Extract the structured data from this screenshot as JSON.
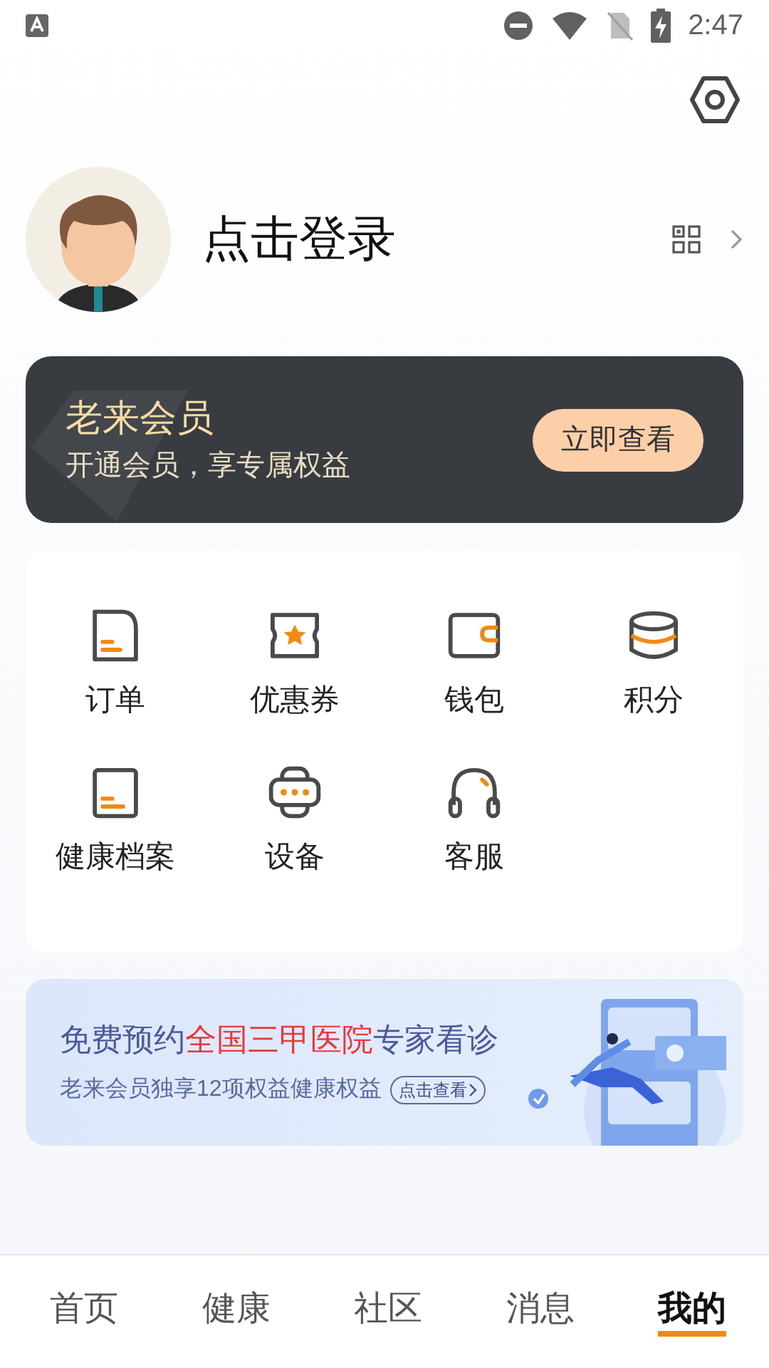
{
  "status_bar": {
    "time": "2:47"
  },
  "profile": {
    "name": "点击登录"
  },
  "member_card": {
    "title": "老来会员",
    "subtitle": "开通会员，享专属权益",
    "button": "立即查看"
  },
  "services": [
    {
      "kind": "order",
      "label": "订单"
    },
    {
      "kind": "coupon",
      "label": "优惠券"
    },
    {
      "kind": "wallet",
      "label": "钱包"
    },
    {
      "kind": "points",
      "label": "积分"
    },
    {
      "kind": "record",
      "label": "健康档案"
    },
    {
      "kind": "device",
      "label": "设备"
    },
    {
      "kind": "support",
      "label": "客服"
    }
  ],
  "banner": {
    "headline": [
      {
        "text": "免费预约",
        "highlight": false
      },
      {
        "text": "全国三甲医院",
        "highlight": true
      },
      {
        "text": "专家看诊",
        "highlight": false
      }
    ],
    "subtitle": "老来会员独享12项权益健康权益",
    "link": "点击查看"
  },
  "tabs": [
    {
      "label": "首页",
      "selected": false
    },
    {
      "label": "健康",
      "selected": false
    },
    {
      "label": "社区",
      "selected": false
    },
    {
      "label": "消息",
      "selected": false
    },
    {
      "label": "我的",
      "selected": true
    }
  ]
}
